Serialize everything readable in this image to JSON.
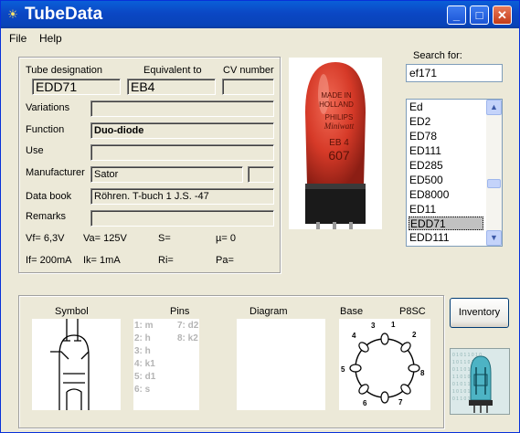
{
  "window": {
    "title": "TubeData",
    "icon": "lightbulb-icon",
    "min_glyph": "_",
    "max_glyph": "□",
    "close_glyph": "✕"
  },
  "menu": {
    "file": "File",
    "help": "Help"
  },
  "details": {
    "tube_designation_label": "Tube designation",
    "tube_designation": "EDD71",
    "equivalent_label": "Equivalent to",
    "equivalent": "EB4",
    "cv_label": "CV number",
    "cv": "",
    "variations_label": "Variations",
    "variations": "",
    "function_label": "Function",
    "function": "Duo-diode",
    "use_label": "Use",
    "use": "",
    "manufacturer_label": "Manufacturer",
    "manufacturer": "Sator",
    "manufacturer_extra": "",
    "databook_label": "Data book",
    "databook": "Röhren. T-buch 1 J.S. -47",
    "remarks_label": "Remarks",
    "remarks": ""
  },
  "params": {
    "vf": "Vf= 6,3V",
    "va": "Va= 125V",
    "s": "S=",
    "mu": "µ=   0",
    "if": "If= 200mA",
    "ik": "Ik=  1mA",
    "ri": "Ri=",
    "pa": "Pa="
  },
  "search": {
    "label": "Search for:",
    "value": "ef171"
  },
  "list": {
    "items": [
      "Ed",
      "ED2",
      "ED78",
      "ED111",
      "ED285",
      "ED500",
      "ED8000",
      "ED11",
      "EDD71",
      "EDD111"
    ],
    "selected": "EDD71"
  },
  "lower": {
    "symbol_label": "Symbol",
    "pins_label": "Pins",
    "diagram_label": "Diagram",
    "base_label": "Base",
    "base_type": "P8SC",
    "pins": {
      "p1": "1: m",
      "p2": "2: h",
      "p3": "3: h",
      "p4": "4: k1",
      "p5": "5: d1",
      "p6": "6: s",
      "p7": "7: d2",
      "p8": "8: k2"
    },
    "base_numbers": {
      "n1": "1",
      "n2": "2",
      "n3": "3",
      "n4": "4",
      "n5": "5",
      "n6": "6",
      "n7": "7",
      "n8": "8"
    }
  },
  "inventory_button": "Inventory",
  "photo_text": {
    "line1": "MADE IN",
    "line2": "HOLLAND",
    "brand": "PHILIPS",
    "model": "EB 4",
    "code": "607"
  }
}
